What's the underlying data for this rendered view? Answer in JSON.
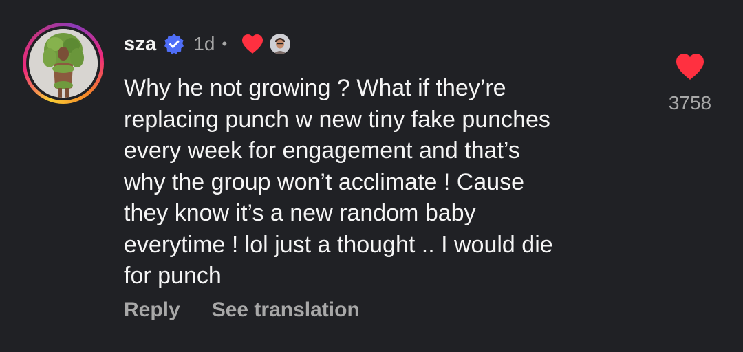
{
  "comment": {
    "username": "sza",
    "verified": true,
    "time": "1d",
    "separator": "•",
    "text": "Why he not growing ? What if they’re\nreplacing punch w new tiny fake punches\nevery week for engagement and that’s\nwhy the group won’t acclimate ! Cause\nthey know it’s a new random baby\neverytime ! lol just a thought .. I would die\nfor punch",
    "actions": {
      "reply": "Reply",
      "translate": "See translation"
    },
    "likes": "3758"
  },
  "icons": {
    "verified": "verified-badge-icon",
    "creator_heart": "heart-icon",
    "like": "heart-icon"
  },
  "colors": {
    "background": "#202125",
    "text": "#f5f5f5",
    "muted": "#a8a8a8",
    "heart": "#ff3040",
    "verified": "#4f6ef7"
  }
}
